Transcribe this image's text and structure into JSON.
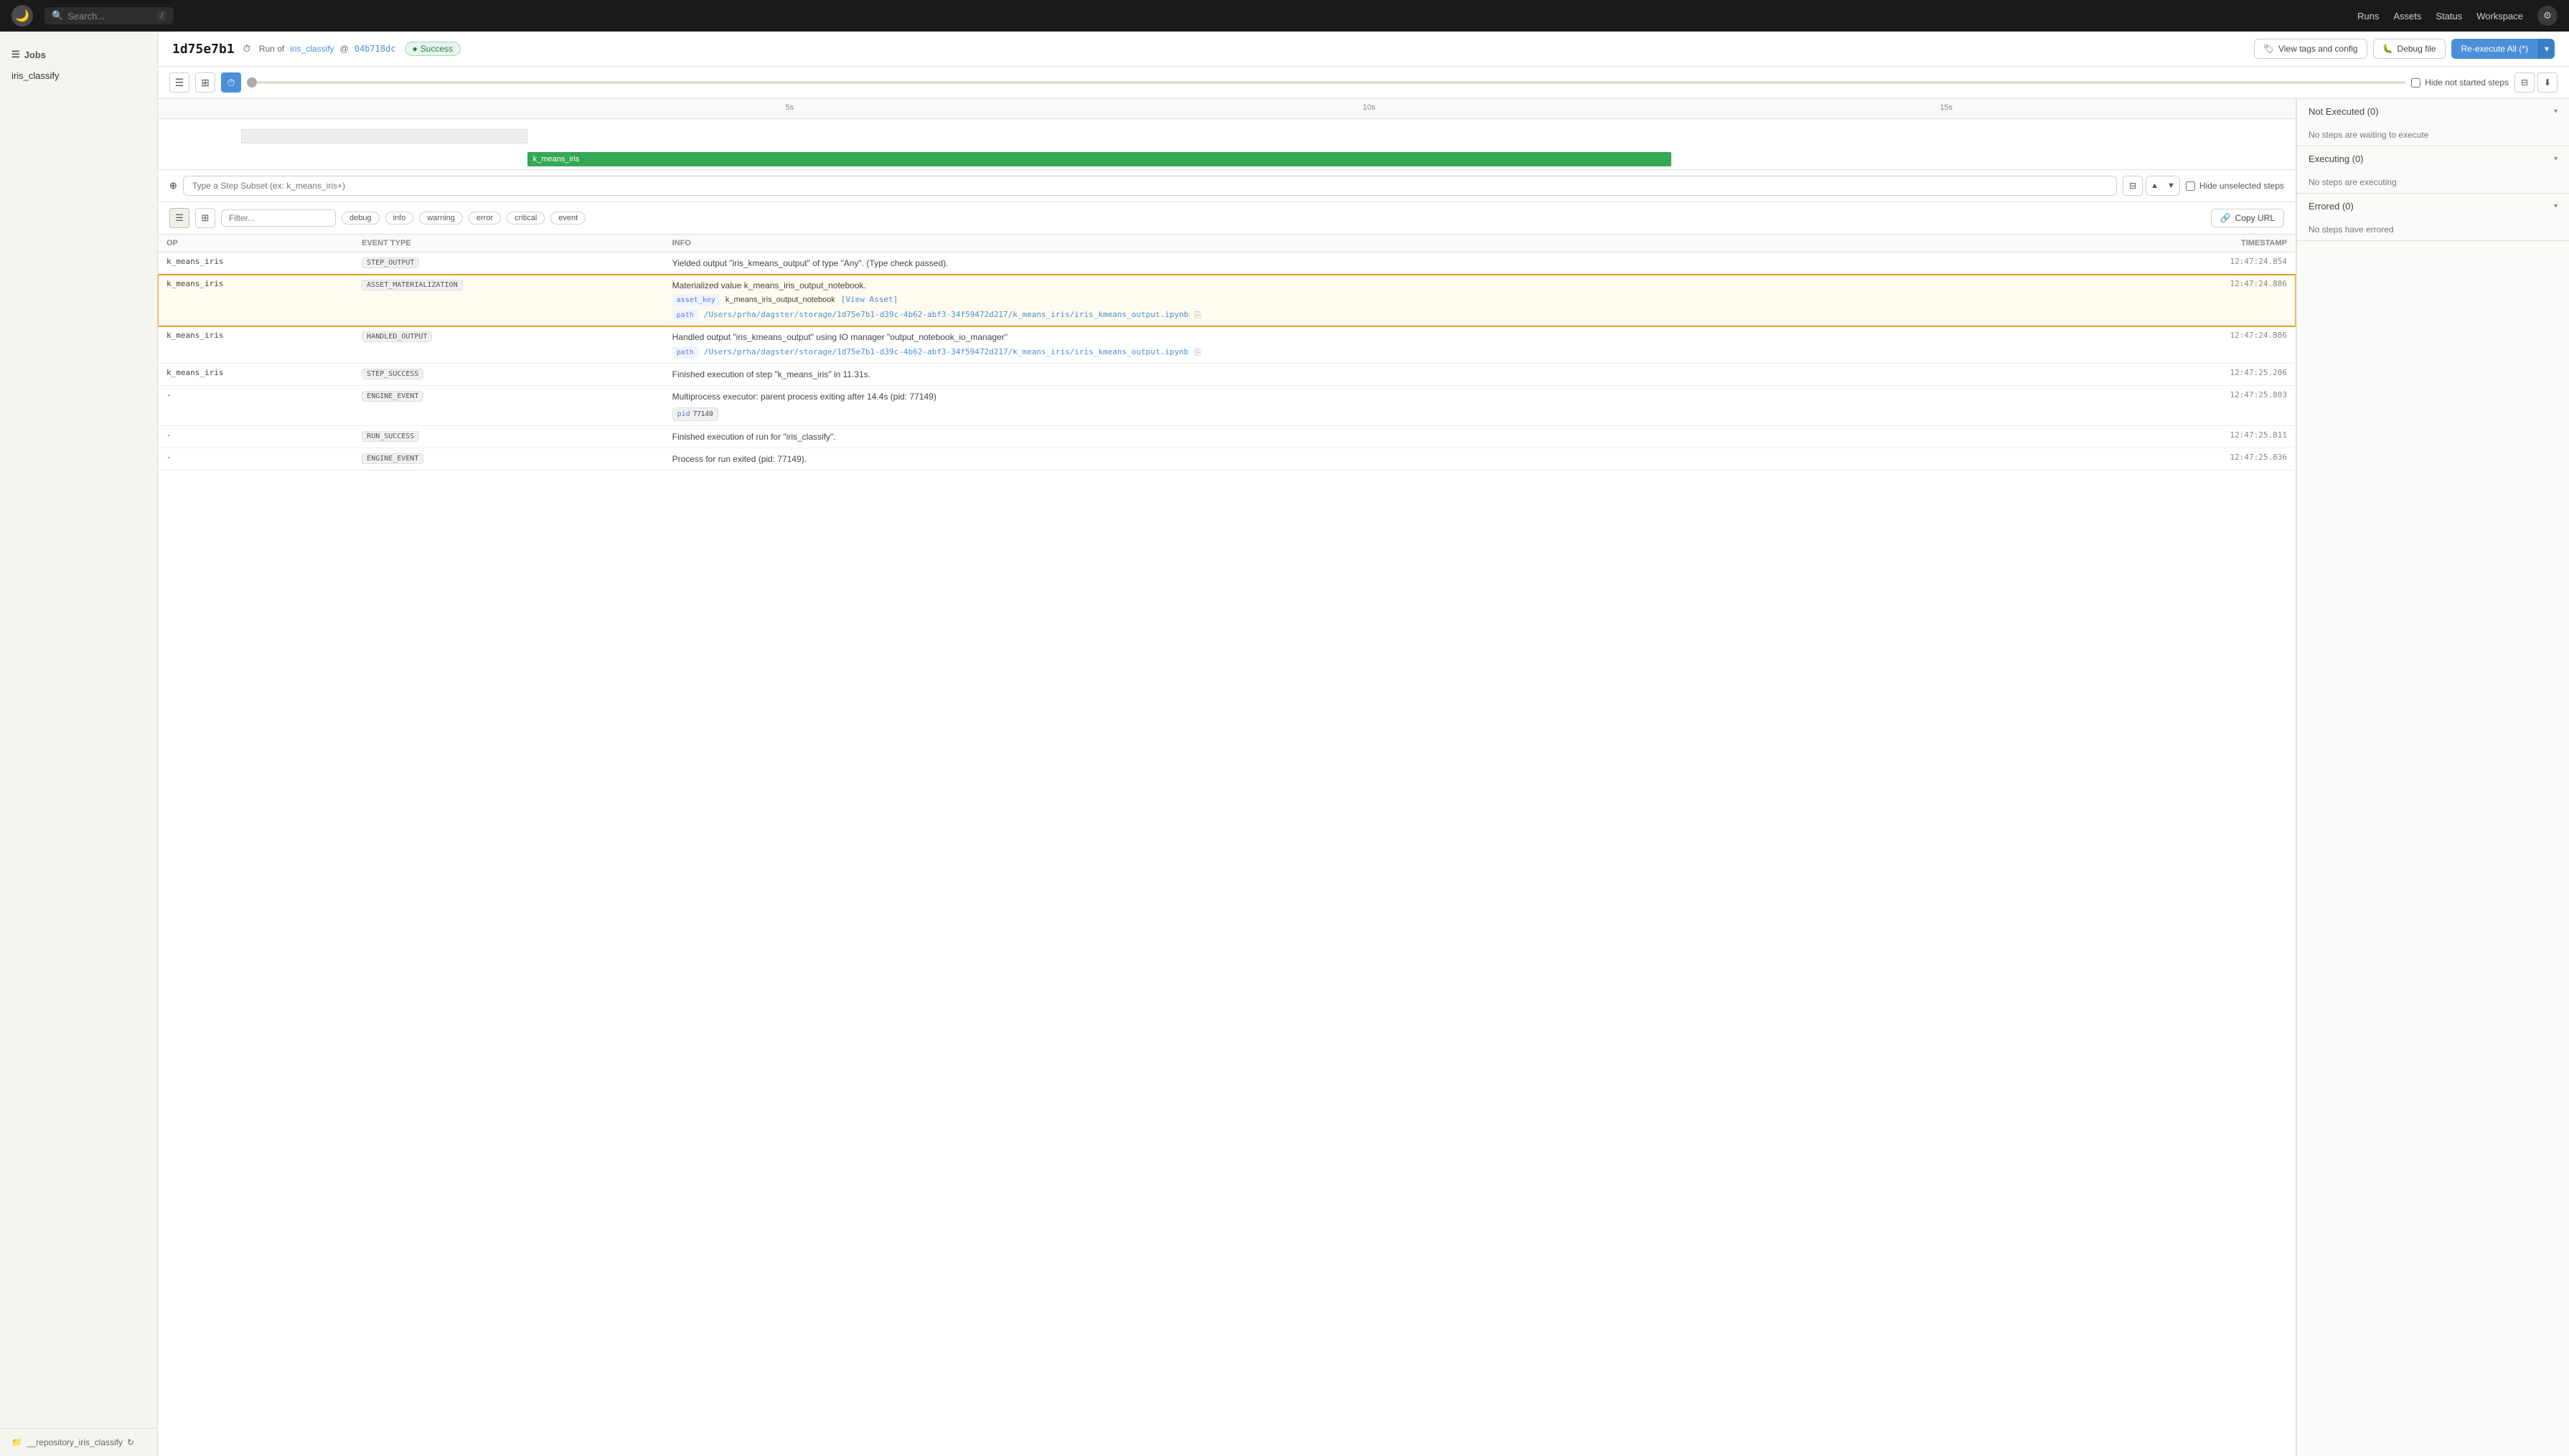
{
  "topnav": {
    "search_placeholder": "Search...",
    "search_shortcut": "/",
    "links": [
      "Runs",
      "Assets",
      "Status",
      "Workspace"
    ],
    "logo_symbol": "🌙"
  },
  "sidebar": {
    "section_label": "Jobs",
    "items": [
      "iris_classify"
    ],
    "footer_repo": "__repository_iris_classify"
  },
  "run_header": {
    "run_id": "1d75e7b1",
    "run_of_label": "Run of",
    "job_name": "iris_classify",
    "at_symbol": "@",
    "commit": "04b718dc",
    "status": "Success",
    "btn_view_tags": "View tags and config",
    "btn_debug": "Debug file",
    "btn_reexecute": "Re-execute All (*)"
  },
  "toolbar": {
    "hide_not_started_label": "Hide not started steps",
    "timeline_markers": [
      "5s",
      "10s",
      "15s"
    ]
  },
  "gantt": {
    "rows": [
      {
        "label": "",
        "type": "placeholder",
        "offset_pct": 0,
        "width_pct": 14
      },
      {
        "label": "k_means_iris",
        "type": "green",
        "offset_pct": 14,
        "width_pct": 50
      }
    ]
  },
  "step_subset": {
    "placeholder": "Type a Step Subset (ex: k_means_iris+)",
    "hide_unselected_label": "Hide unselected steps"
  },
  "right_panel": {
    "sections": [
      {
        "title": "Not Executed (0)",
        "body": "No steps are waiting to execute",
        "expanded": true
      },
      {
        "title": "Executing (0)",
        "body": "No steps are executing",
        "expanded": true
      },
      {
        "title": "Errored (0)",
        "body": "No steps have errored",
        "expanded": true
      }
    ]
  },
  "log_toolbar": {
    "filter_placeholder": "Filter...",
    "tags": [
      "debug",
      "info",
      "warning",
      "error",
      "critical",
      "event"
    ],
    "copy_url_label": "Copy URL"
  },
  "log_table": {
    "columns": [
      "OP",
      "EVENT TYPE",
      "INFO",
      "TIMESTAMP"
    ],
    "rows": [
      {
        "op": "k_means_iris",
        "event_type": "STEP_OUTPUT",
        "info_main": "Yielded output \"iris_kmeans_output\" of type \"Any\". (Type check passed).",
        "info_subs": [],
        "timestamp": "12:47:24.854",
        "highlighted": false
      },
      {
        "op": "k_means_iris",
        "event_type": "ASSET_MATERIALIZATION",
        "info_main": "Materialized value k_means_iris_output_notebook.",
        "info_subs": [
          {
            "key": "asset_key",
            "value": "k_means_iris_output_notebook",
            "link": "[View Asset]",
            "link_url": "#"
          },
          {
            "key": "path",
            "value": "/Users/prha/dagster/storage/1d75e7b1-d39c-4b62-abf3-34f59472d217/k_means_iris/iris_kmeans_output.ipynb",
            "copyable": true
          }
        ],
        "timestamp": "12:47:24.886",
        "highlighted": true
      },
      {
        "op": "k_means_iris",
        "event_type": "HANDLED_OUTPUT",
        "info_main": "Handled output \"iris_kmeans_output\" using IO manager \"output_notebook_io_manager\"",
        "info_subs": [
          {
            "key": "path",
            "value": "/Users/prha/dagster/storage/1d75e7b1-d39c-4b62-abf3-34f59472d217/k_means_iris/iris_kmeans_output.ipynb",
            "copyable": true
          }
        ],
        "timestamp": "12:47:24.886",
        "highlighted": false
      },
      {
        "op": "k_means_iris",
        "event_type": "STEP_SUCCESS",
        "info_main": "Finished execution of step \"k_means_iris\" in 11.31s.",
        "info_subs": [],
        "timestamp": "12:47:25.206",
        "highlighted": false
      },
      {
        "op": "-",
        "event_type": "ENGINE_EVENT",
        "info_main": "Multiprocess executor: parent process exiting after 14.4s (pid: 77149)",
        "info_subs": [
          {
            "key": "pid",
            "value": "77149",
            "is_pid": true
          }
        ],
        "timestamp": "12:47:25.803",
        "highlighted": false
      },
      {
        "op": "-",
        "event_type": "RUN_SUCCESS",
        "info_main": "Finished execution of run for \"iris_classify\".",
        "info_subs": [],
        "timestamp": "12:47:25.811",
        "highlighted": false
      },
      {
        "op": "-",
        "event_type": "ENGINE_EVENT",
        "info_main": "Process for run exited (pid: 77149).",
        "info_subs": [],
        "timestamp": "12:47:25.836",
        "highlighted": false
      }
    ]
  },
  "icons": {
    "search": "🔍",
    "clock": "⏱",
    "filter": "⊟",
    "download": "⬇",
    "tag": "🏷",
    "link": "🔗",
    "copy": "⎘",
    "settings": "⚙"
  }
}
